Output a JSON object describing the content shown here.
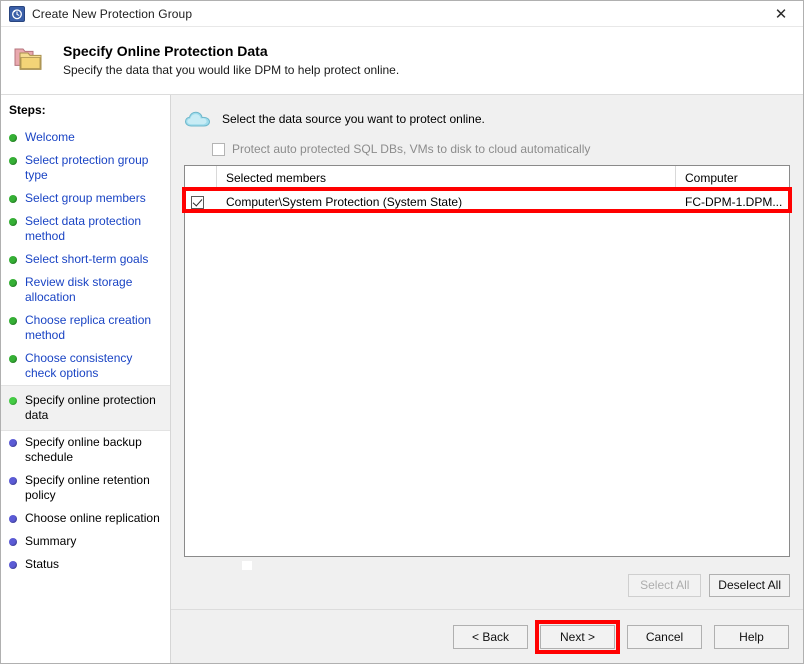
{
  "window": {
    "title": "Create New Protection Group",
    "title_icon": "history-clock-icon",
    "close_icon": "close-icon"
  },
  "header": {
    "icon": "folders-icon",
    "title": "Specify Online Protection Data",
    "subtitle": "Specify the data that you would like DPM to help protect online."
  },
  "sidebar": {
    "label": "Steps:",
    "items": [
      {
        "label": "Welcome",
        "state": "done"
      },
      {
        "label": "Select protection group type",
        "state": "done"
      },
      {
        "label": "Select group members",
        "state": "done"
      },
      {
        "label": "Select data protection method",
        "state": "done"
      },
      {
        "label": "Select short-term goals",
        "state": "done"
      },
      {
        "label": "Review disk storage allocation",
        "state": "done"
      },
      {
        "label": "Choose replica creation method",
        "state": "done"
      },
      {
        "label": "Choose consistency check options",
        "state": "done"
      },
      {
        "label": "Specify online protection data",
        "state": "current"
      },
      {
        "label": "Specify online backup schedule",
        "state": "todo"
      },
      {
        "label": "Specify online retention policy",
        "state": "todo"
      },
      {
        "label": "Choose online replication",
        "state": "todo"
      },
      {
        "label": "Summary",
        "state": "todo"
      },
      {
        "label": "Status",
        "state": "todo"
      }
    ]
  },
  "main": {
    "cloud_icon": "cloud-icon",
    "intro": "Select the data source you want to protect online.",
    "auto_protect": {
      "label": "Protect auto protected SQL DBs, VMs to disk to cloud automatically",
      "checked": false,
      "enabled": false
    },
    "table": {
      "columns": [
        "Selected members",
        "Computer"
      ],
      "rows": [
        {
          "checked": true,
          "member": "Computer\\System Protection (System State)",
          "computer": "FC-DPM-1.DPM..."
        }
      ]
    },
    "select_all_label": "Select All",
    "select_all_enabled": false,
    "deselect_all_label": "Deselect All",
    "deselect_all_enabled": true
  },
  "footer": {
    "back_label": "< Back",
    "next_label": "Next >",
    "cancel_label": "Cancel",
    "help_label": "Help"
  },
  "annotations": {
    "highlight_color": "#ff0000"
  }
}
